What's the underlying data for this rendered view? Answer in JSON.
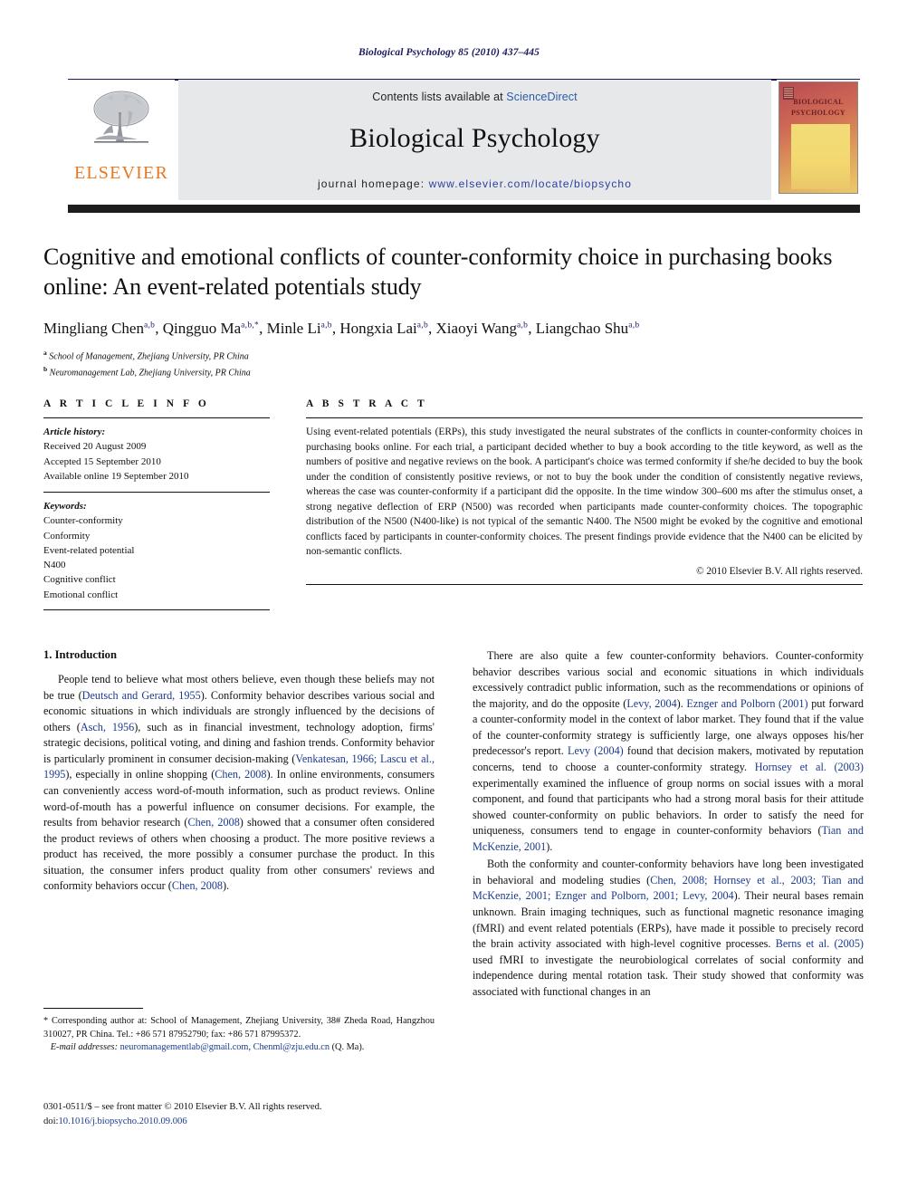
{
  "running_head": "Biological Psychology 85 (2010) 437–445",
  "masthead": {
    "contents_prefix": "Contents lists available at ",
    "sciencedirect": "ScienceDirect",
    "journal_name": "Biological Psychology",
    "homepage_prefix": "journal homepage: ",
    "homepage_url": "www.elsevier.com/locate/biopsycho",
    "publisher_logo_text": "ELSEVIER",
    "cover_title_line1": "BIOLOGICAL",
    "cover_title_line2": "PSYCHOLOGY",
    "accent_orange": "#E87722",
    "accent_navy": "#1a1a5e",
    "link_blue": "#2a5caa"
  },
  "article": {
    "title": "Cognitive and emotional conflicts of counter-conformity choice in purchasing books online: An event-related potentials study",
    "authors_html": "Mingliang Chen<sup>a,b</sup>, Qingguo Ma<sup>a,b,*</sup>, Minle Li<sup>a,b</sup>, Hongxia Lai<sup>a,b</sup>, Xiaoyi Wang<sup>a,b</sup>, Liangchao Shu<sup>a,b</sup>",
    "affiliation_a": "School of Management, Zhejiang University, PR China",
    "affiliation_b": "Neuromanagement Lab, Zhejiang University, PR China"
  },
  "article_info": {
    "heading": "A R T I C L E  I N F O",
    "history_label": "Article history:",
    "history": [
      "Received 20 August 2009",
      "Accepted 15 September 2010",
      "Available online 19 September 2010"
    ],
    "keywords_label": "Keywords:",
    "keywords": [
      "Counter-conformity",
      "Conformity",
      "Event-related potential",
      "N400",
      "Cognitive conflict",
      "Emotional conflict"
    ]
  },
  "abstract": {
    "heading": "A B S T R A C T",
    "text": "Using event-related potentials (ERPs), this study investigated the neural substrates of the conflicts in counter-conformity choices in purchasing books online. For each trial, a participant decided whether to buy a book according to the title keyword, as well as the numbers of positive and negative reviews on the book. A participant's choice was termed conformity if she/he decided to buy the book under the condition of consistently positive reviews, or not to buy the book under the condition of consistently negative reviews, whereas the case was counter-conformity if a participant did the opposite. In the time window 300–600 ms after the stimulus onset, a strong negative deflection of ERP (N500) was recorded when participants made counter-conformity choices. The topographic distribution of the N500 (N400-like) is not typical of the semantic N400. The N500 might be evoked by the cognitive and emotional conflicts faced by participants in counter-conformity choices. The present findings provide evidence that the N400 can be elicited by non-semantic conflicts.",
    "copyright": "© 2010 Elsevier B.V. All rights reserved."
  },
  "body": {
    "section_heading": "1.  Introduction",
    "left_paragraphs": [
      {
        "id": "p1",
        "segments": [
          {
            "t": "People tend to believe what most others believe, even though these beliefs may not be true (",
            "link": false
          },
          {
            "t": "Deutsch and Gerard, 1955",
            "link": true
          },
          {
            "t": "). Conformity behavior describes various social and economic situations in which individuals are strongly influenced by the decisions of others (",
            "link": false
          },
          {
            "t": "Asch, 1956",
            "link": true
          },
          {
            "t": "), such as in financial investment, technology adoption, firms' strategic decisions, political voting, and dining and fashion trends. Conformity behavior is particularly prominent in consumer decision-making (",
            "link": false
          },
          {
            "t": "Venkatesan, 1966; Lascu et al., 1995",
            "link": true
          },
          {
            "t": "), especially in online shopping (",
            "link": false
          },
          {
            "t": "Chen, 2008",
            "link": true
          },
          {
            "t": "). In online environments, consumers can conveniently access word-of-mouth information, such as product reviews. Online word-of-mouth has a powerful influence on consumer decisions. For example, the results from behavior research (",
            "link": false
          },
          {
            "t": "Chen, 2008",
            "link": true
          },
          {
            "t": ") showed that a consumer often considered the product reviews of others when choosing a product. The more positive reviews a product has received, the more possibly a consumer purchase the product. In this situation, the consumer infers product quality from other consumers' reviews and conformity behaviors occur (",
            "link": false
          },
          {
            "t": "Chen, 2008",
            "link": true
          },
          {
            "t": ").",
            "link": false
          }
        ]
      }
    ],
    "right_paragraphs": [
      {
        "id": "p2",
        "segments": [
          {
            "t": "There are also quite a few counter-conformity behaviors. Counter-conformity behavior describes various social and economic situations in which individuals excessively contradict public information, such as the recommendations or opinions of the majority, and do the opposite (",
            "link": false
          },
          {
            "t": "Levy, 2004",
            "link": true
          },
          {
            "t": "). ",
            "link": false
          },
          {
            "t": "Eznger and Polborn (2001)",
            "link": true
          },
          {
            "t": " put forward a counter-conformity model in the context of labor market. They found that if the value of the counter-conformity strategy is sufficiently large, one always opposes his/her predecessor's report. ",
            "link": false
          },
          {
            "t": "Levy (2004)",
            "link": true
          },
          {
            "t": " found that decision makers, motivated by reputation concerns, tend to choose a counter-conformity strategy. ",
            "link": false
          },
          {
            "t": "Hornsey et al. (2003)",
            "link": true
          },
          {
            "t": " experimentally examined the influence of group norms on social issues with a moral component, and found that participants who had a strong moral basis for their attitude showed counter-conformity on public behaviors. In order to satisfy the need for uniqueness, consumers tend to engage in counter-conformity behaviors (",
            "link": false
          },
          {
            "t": "Tian and McKenzie, 2001",
            "link": true
          },
          {
            "t": ").",
            "link": false
          }
        ]
      },
      {
        "id": "p3",
        "segments": [
          {
            "t": "Both the conformity and counter-conformity behaviors have long been investigated in behavioral and modeling studies (",
            "link": false
          },
          {
            "t": "Chen, 2008; Hornsey et al., 2003; Tian and McKenzie, 2001; Eznger and Polborn, 2001; Levy, 2004",
            "link": true
          },
          {
            "t": "). Their neural bases remain unknown. Brain imaging techniques, such as functional magnetic resonance imaging (fMRI) and event related potentials (ERPs), have made it possible to precisely record the brain activity associated with high-level cognitive processes. ",
            "link": false
          },
          {
            "t": "Berns et al. (2005)",
            "link": true
          },
          {
            "t": " used fMRI to investigate the neurobiological correlates of social conformity and independence during mental rotation task. Their study showed that conformity was associated with functional changes in an",
            "link": false
          }
        ]
      }
    ]
  },
  "footnotes": {
    "corresponding": "* Corresponding author at: School of Management, Zhejiang University, 38# Zheda Road, Hangzhou 310027, PR China. Tel.: +86 571 87952790; fax: +86 571 87995372.",
    "email_label": "E-mail addresses:",
    "email_1": "neuromanagementlab@gmail.com",
    "email_sep": ", ",
    "email_2": "Chenml@zju.edu.cn",
    "email_tail": "(Q. Ma).",
    "imprint_line": "0301-0511/$ – see front matter © 2010 Elsevier B.V. All rights reserved.",
    "doi_label": "doi:",
    "doi_value": "10.1016/j.biopsycho.2010.09.006"
  }
}
